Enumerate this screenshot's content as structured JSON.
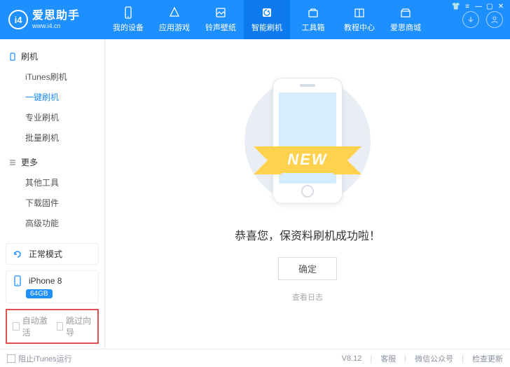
{
  "brand": {
    "logo_letter": "i4",
    "name": "爱思助手",
    "url": "www.i4.cn"
  },
  "nav": {
    "items": [
      {
        "label": "我的设备"
      },
      {
        "label": "应用游戏"
      },
      {
        "label": "铃声壁纸"
      },
      {
        "label": "智能刷机"
      },
      {
        "label": "工具箱"
      },
      {
        "label": "教程中心"
      },
      {
        "label": "爱思商城"
      }
    ],
    "active_index": 3
  },
  "sidebar": {
    "sections": [
      {
        "title": "刷机",
        "items": [
          "iTunes刷机",
          "一键刷机",
          "专业刷机",
          "批量刷机"
        ],
        "active_index": 1
      },
      {
        "title": "更多",
        "items": [
          "其他工具",
          "下载固件",
          "高级功能"
        ]
      }
    ],
    "mode": {
      "label": "正常模式"
    },
    "device": {
      "name": "iPhone 8",
      "capacity": "64GB"
    },
    "options": {
      "auto_activate": "自动激活",
      "skip_guide": "跳过向导"
    }
  },
  "main": {
    "ribbon_text": "NEW",
    "message": "恭喜您，保资料刷机成功啦！",
    "confirm": "确定",
    "view_log": "查看日志"
  },
  "footer": {
    "block_itunes": "阻止iTunes运行",
    "version": "V8.12",
    "support": "客服",
    "wechat": "微信公众号",
    "check_update": "检查更新"
  }
}
